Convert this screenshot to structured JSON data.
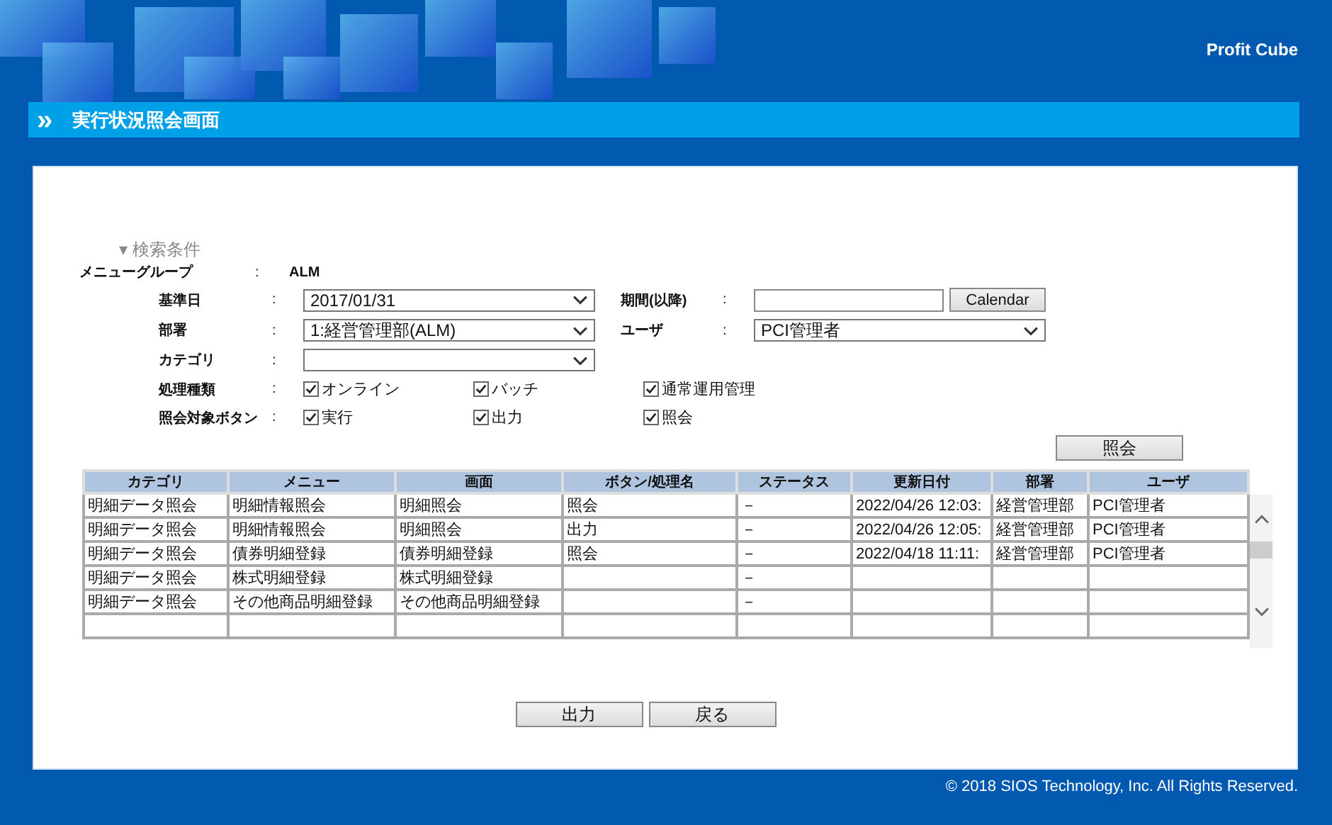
{
  "header": {
    "brand": "Profit Cube",
    "title_icon": "»",
    "title": "実行状況照会画面"
  },
  "search": {
    "section_label": "▾ 検索条件",
    "menu_group": {
      "label": "メニューグループ",
      "colon": ":",
      "value": "ALM"
    },
    "fields": [
      {
        "label": "基準日",
        "colon": ":",
        "kind": "select",
        "value": "2017/01/31"
      },
      {
        "label": "期間(以降)",
        "colon": ":",
        "kind": "date",
        "button": "Calendar"
      },
      {
        "label": "部署",
        "colon": ":",
        "kind": "select",
        "value": "1:経営管理部(ALM)"
      },
      {
        "label": "ユーザ",
        "colon": ":",
        "kind": "select",
        "value": "PCI管理者"
      },
      {
        "label": "カテゴリ",
        "colon": ":",
        "kind": "select"
      }
    ],
    "check_groups": [
      {
        "label": "処理種類",
        "colon": ":",
        "options": [
          {
            "label": "オンライン",
            "checked": true
          },
          {
            "label": "バッチ",
            "checked": true
          },
          {
            "label": "通常運用管理",
            "checked": true
          }
        ]
      },
      {
        "label": "照会対象ボタン",
        "colon": ":",
        "options": [
          {
            "label": "実行",
            "checked": true
          },
          {
            "label": "出力",
            "checked": true
          },
          {
            "label": "照会",
            "checked": true
          }
        ]
      }
    ],
    "query_button": "照会"
  },
  "table": {
    "columns": [
      "カテゴリ",
      "メニュー",
      "画面",
      "ボタン/処理名",
      "ステータス",
      "更新日付",
      "部署",
      "ユーザ"
    ],
    "rows": [
      [
        "明細データ照会",
        "明細情報照会",
        "明細照会",
        "照会",
        "－",
        "2022/04/26 12:03:",
        "経営管理部",
        "PCI管理者"
      ],
      [
        "明細データ照会",
        "明細情報照会",
        "明細照会",
        "出力",
        "－",
        "2022/04/26 12:05:",
        "経営管理部",
        "PCI管理者"
      ],
      [
        "明細データ照会",
        "債券明細登録",
        "債券明細登録",
        "照会",
        "－",
        "2022/04/18 11:11:",
        "経営管理部",
        "PCI管理者"
      ],
      [
        "明細データ照会",
        "株式明細登録",
        "株式明細登録",
        "",
        "－",
        "",
        "",
        ""
      ],
      [
        "明細データ照会",
        "その他商品明細登録",
        "その他商品明細登録",
        "",
        "－",
        "",
        "",
        ""
      ]
    ]
  },
  "buttons": [
    "出力",
    "戻る"
  ],
  "footer": "© 2018 SIOS Technology, Inc. All Rights Reserved."
}
